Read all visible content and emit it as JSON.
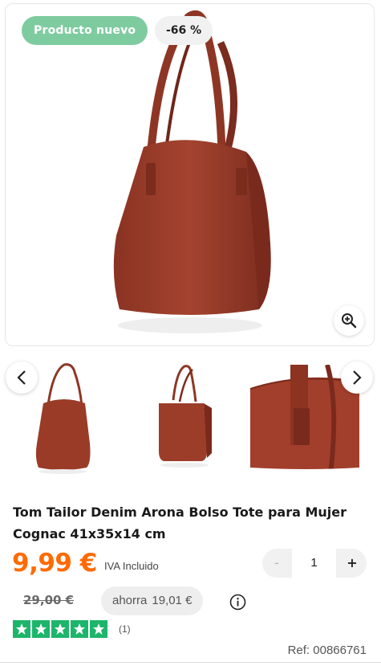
{
  "badges": {
    "new": "Producto nuevo",
    "discount": "-66 %"
  },
  "icons": {
    "zoom": "zoom-in-icon",
    "prev": "chevron-left-icon",
    "next": "chevron-right-icon",
    "info": "info-icon",
    "star": "star-icon"
  },
  "colors": {
    "price": "#ff6a00",
    "badge_new": "#7fcba0",
    "rating": "#1db56b",
    "bag": "#9a3b28"
  },
  "gallery": {
    "thumbnails": [
      "bag-front-thumbnail",
      "bag-side-thumbnail",
      "bag-detail-thumbnail"
    ]
  },
  "product": {
    "title": "Tom Tailor Denim Arona Bolso Tote para Mujer Cognac 41x35x14 cm",
    "price": "9,99 €",
    "tax_note": "IVA Incluido",
    "old_price": "29,00 €",
    "savings_label": "ahorra",
    "savings_amount": "19,01 €",
    "rating_stars": 5,
    "review_count": "(1)",
    "reference": "Ref: 00866761"
  },
  "quantity": {
    "minus": "-",
    "value": "1",
    "plus": "+"
  }
}
